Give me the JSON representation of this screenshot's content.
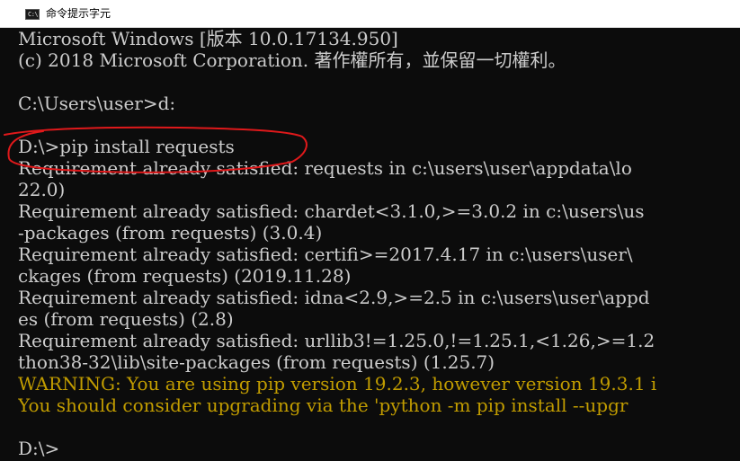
{
  "window": {
    "title": "命令提示字元",
    "icon_label": "C:\\",
    "icon": "console-window-icon"
  },
  "colors": {
    "console_bg": "#0c0c0c",
    "console_text": "#cccccc",
    "warning_text": "#c19c00",
    "annotation_stroke": "#e0191b"
  },
  "console": {
    "lines": [
      {
        "text": "Microsoft Windows [版本 10.0.17134.950]",
        "kind": "normal"
      },
      {
        "text": "(c) 2018 Microsoft Corporation. 著作權所有，並保留一切權利。",
        "kind": "normal"
      },
      {
        "text": "",
        "kind": "normal"
      },
      {
        "text": "C:\\Users\\user>d:",
        "kind": "normal"
      },
      {
        "text": "",
        "kind": "normal"
      },
      {
        "text": "D:\\>pip install requests",
        "kind": "normal"
      },
      {
        "text": "Requirement already satisfied: requests in c:\\users\\user\\appdata\\lo",
        "kind": "normal"
      },
      {
        "text": "22.0)",
        "kind": "normal"
      },
      {
        "text": "Requirement already satisfied: chardet<3.1.0,>=3.0.2 in c:\\users\\us",
        "kind": "normal"
      },
      {
        "text": "-packages (from requests) (3.0.4)",
        "kind": "normal"
      },
      {
        "text": "Requirement already satisfied: certifi>=2017.4.17 in c:\\users\\user\\",
        "kind": "normal"
      },
      {
        "text": "ckages (from requests) (2019.11.28)",
        "kind": "normal"
      },
      {
        "text": "Requirement already satisfied: idna<2.9,>=2.5 in c:\\users\\user\\appd",
        "kind": "normal"
      },
      {
        "text": "es (from requests) (2.8)",
        "kind": "normal"
      },
      {
        "text": "Requirement already satisfied: urllib3!=1.25.0,!=1.25.1,<1.26,>=1.2",
        "kind": "normal"
      },
      {
        "text": "thon38-32\\lib\\site-packages (from requests) (1.25.7)",
        "kind": "normal"
      },
      {
        "text": "WARNING: You are using pip version 19.2.3, however version 19.3.1 i",
        "kind": "warn"
      },
      {
        "text": "You should consider upgrading via the 'python -m pip install --upgr",
        "kind": "warn"
      },
      {
        "text": "",
        "kind": "normal"
      },
      {
        "text": "D:\\>",
        "kind": "normal"
      }
    ]
  }
}
